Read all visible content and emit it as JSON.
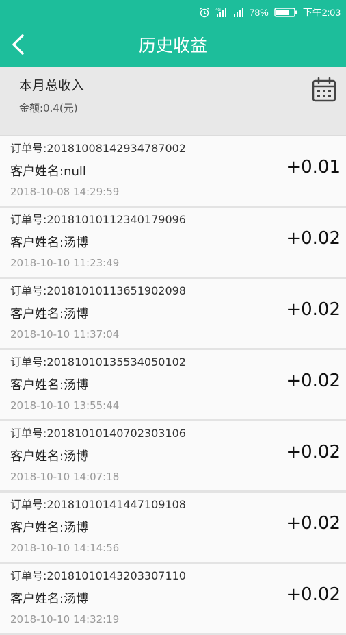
{
  "status_bar": {
    "battery": "78%",
    "time": "下午2:03",
    "network": "4G"
  },
  "header": {
    "title": "历史收益"
  },
  "summary": {
    "title": "本月总收入",
    "amount": "金额:0.4(元)"
  },
  "records": [
    {
      "order_no": "订单号:20181008142934787002",
      "customer": "客户姓名:null",
      "time": "2018-10-08 14:29:59",
      "amount": "+0.01"
    },
    {
      "order_no": "订单号:20181010112340179096",
      "customer": "客户姓名:汤博",
      "time": "2018-10-10 11:23:49",
      "amount": "+0.02"
    },
    {
      "order_no": "订单号:20181010113651902098",
      "customer": "客户姓名:汤博",
      "time": "2018-10-10 11:37:04",
      "amount": "+0.02"
    },
    {
      "order_no": "订单号:20181010135534050102",
      "customer": "客户姓名:汤博",
      "time": "2018-10-10 13:55:44",
      "amount": "+0.02"
    },
    {
      "order_no": "订单号:20181010140702303106",
      "customer": "客户姓名:汤博",
      "time": "2018-10-10 14:07:18",
      "amount": "+0.02"
    },
    {
      "order_no": "订单号:20181010141447109108",
      "customer": "客户姓名:汤博",
      "time": "2018-10-10 14:14:56",
      "amount": "+0.02"
    },
    {
      "order_no": "订单号:20181010143203307110",
      "customer": "客户姓名:汤博",
      "time": "2018-10-10 14:32:19",
      "amount": "+0.02"
    }
  ],
  "colors": {
    "accent": "#1dbe9b",
    "summary_bg": "#e8e8e8",
    "row_bg": "#fafafa"
  },
  "icons": {
    "back": "chevron-left-icon",
    "calendar": "calendar-icon",
    "alarm": "alarm-icon",
    "signal": "signal-icon",
    "battery": "battery-icon"
  }
}
